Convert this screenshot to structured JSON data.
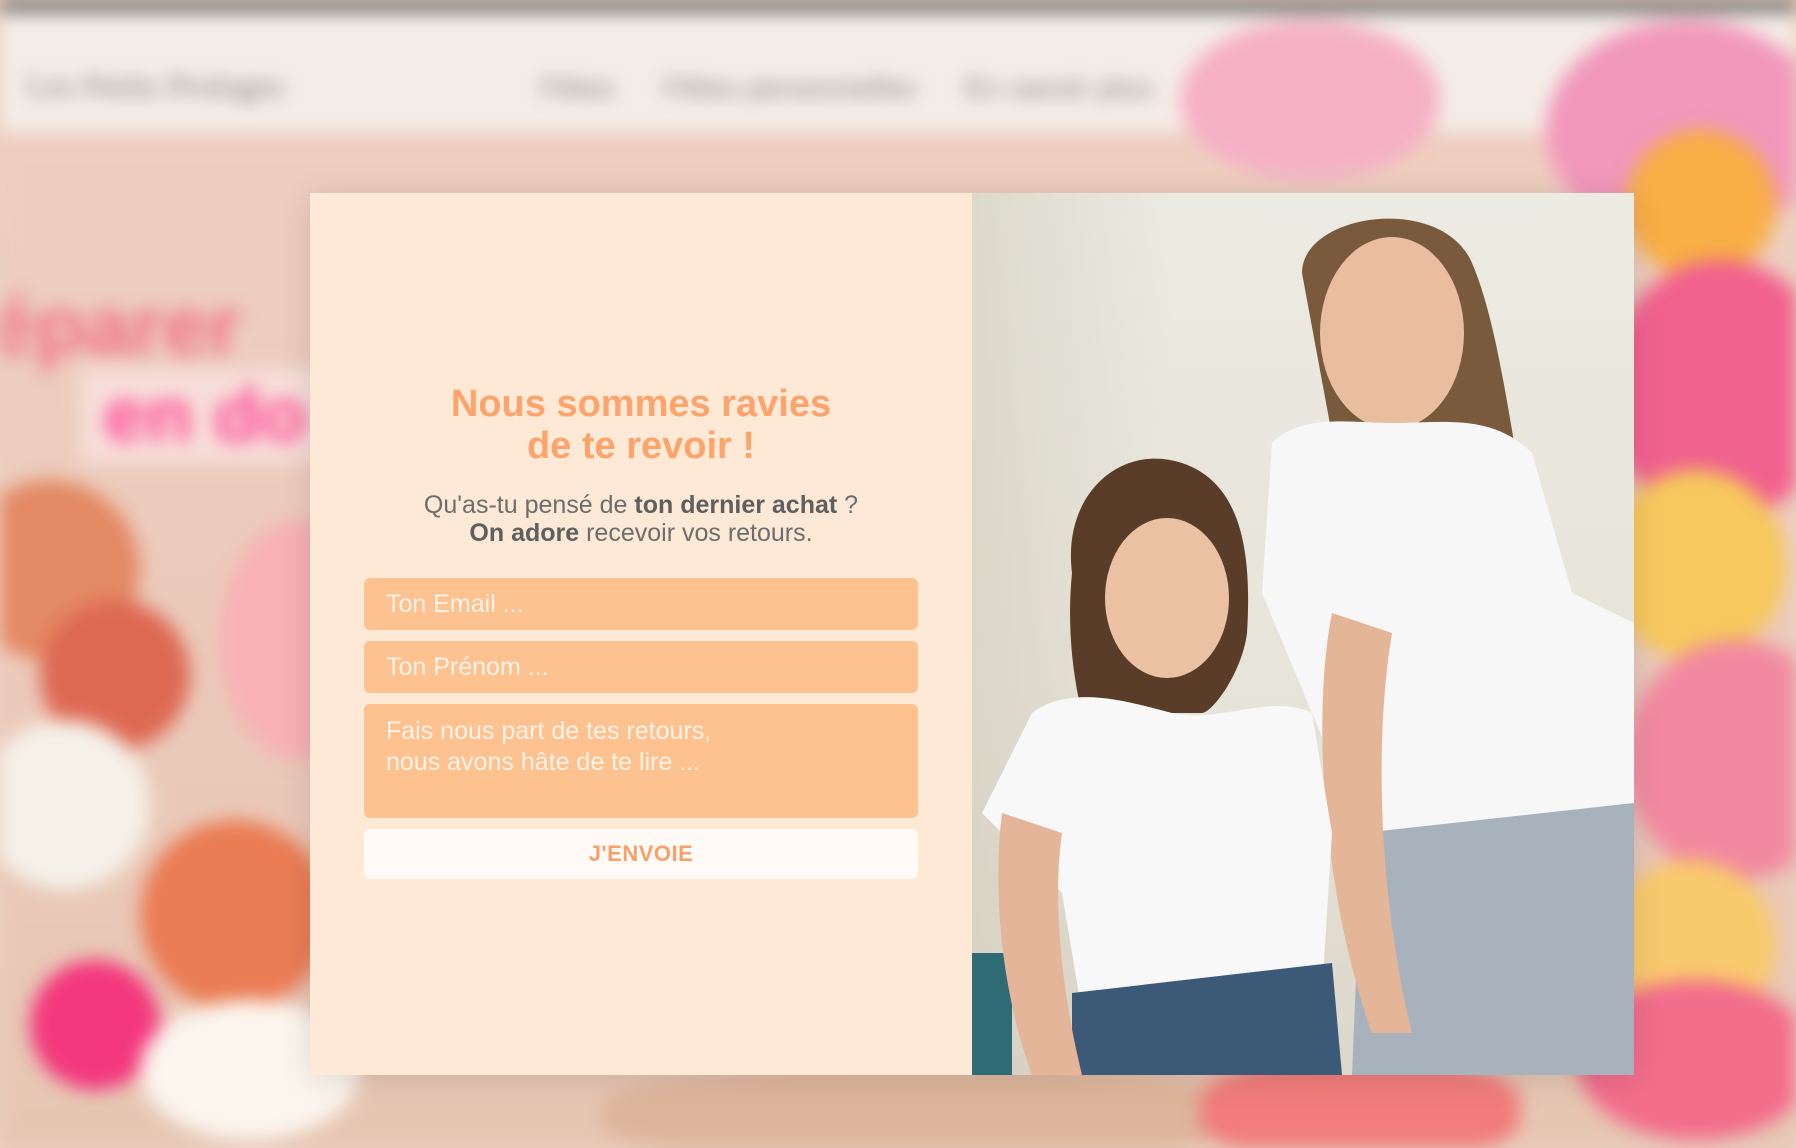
{
  "background_site": {
    "logo": "Les Petits Prolages",
    "nav": [
      "Fêtes",
      "Fêtes personnelles",
      "En savoir plus"
    ],
    "hero_line1": "éparer",
    "hero_line2": "en do"
  },
  "popup": {
    "title_line1": "Nous sommes ravies",
    "title_line2": "de te revoir !",
    "subtitle": {
      "line1_prefix": "Qu'as-tu pensé de ",
      "line1_bold": "ton dernier achat",
      "line1_suffix": " ?",
      "line2_bold": "On adore",
      "line2_suffix": " recevoir vos retours."
    },
    "email_placeholder": "Ton Email ...",
    "name_placeholder": "Ton Prénom ...",
    "message_placeholder": "Fais nous part de tes retours,\nnous avons hâte de te lire ...",
    "submit_label": "J'ENVOIE"
  },
  "colors": {
    "panel_bg": "#fde9d6",
    "accent": "#fca46c",
    "field_bg": "#fec190",
    "button_bg": "#fffaf6"
  }
}
